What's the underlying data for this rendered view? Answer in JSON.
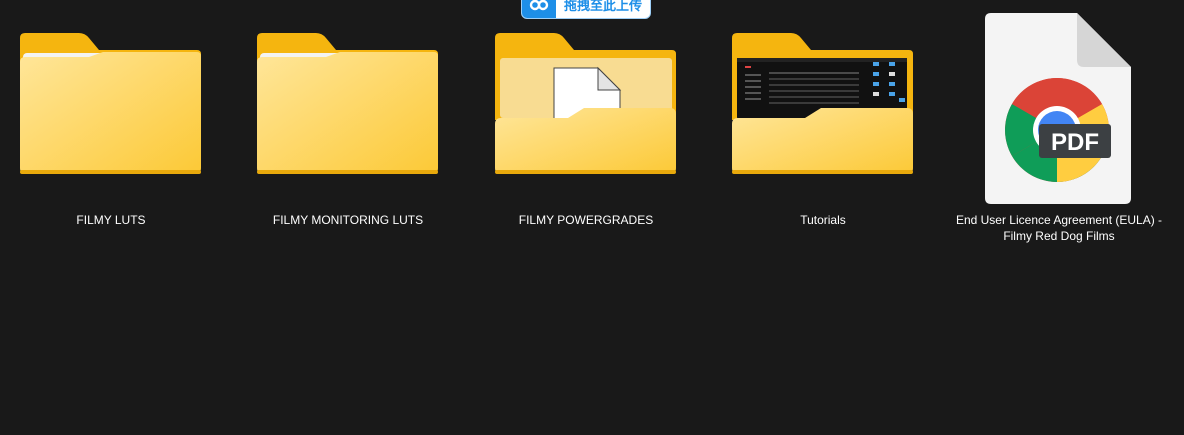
{
  "theme": {
    "background": "#191919",
    "text": "#ffffff",
    "folder_front": "#fdd465",
    "folder_back": "#f6b814",
    "accent": "#1e8fe8"
  },
  "upload_badge": {
    "label": "拖拽至此上传",
    "icon": "cloud-link-icon"
  },
  "items": [
    {
      "label": "FILMY LUTS",
      "type": "folder",
      "icon": "folder-icon"
    },
    {
      "label": "FILMY MONITORING LUTS",
      "type": "folder",
      "icon": "folder-icon"
    },
    {
      "label": "FILMY POWERGRADES",
      "type": "folder",
      "icon": "folder-with-document-icon"
    },
    {
      "label": "Tutorials",
      "type": "folder",
      "icon": "folder-with-screenshot-icon"
    },
    {
      "label_line1": "End User Licence Agreement (EULA) -",
      "label_line2": "Filmy Red Dog Films",
      "type": "pdf",
      "icon": "chrome-pdf-icon",
      "badge": "PDF"
    }
  ]
}
